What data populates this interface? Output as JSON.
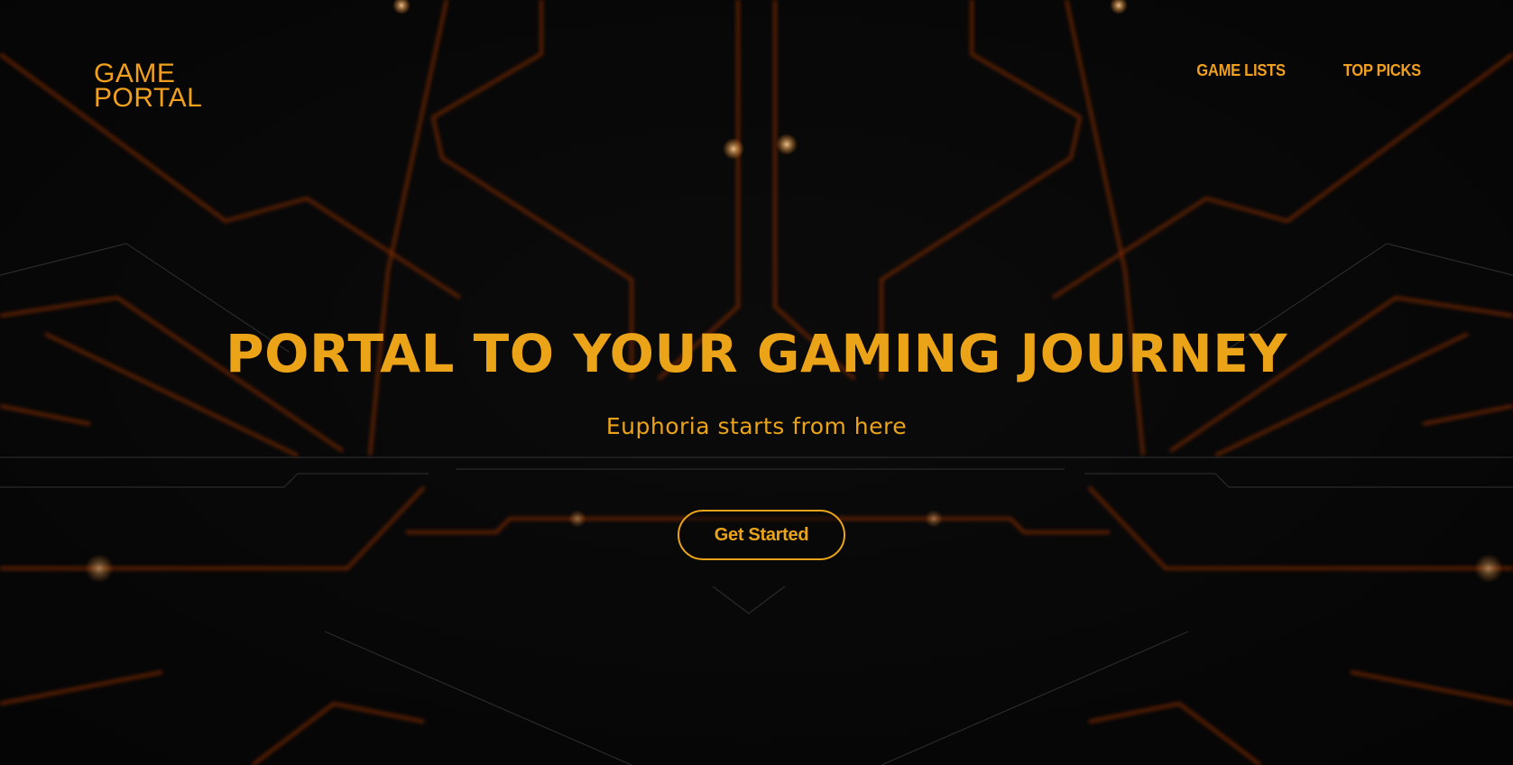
{
  "brand": {
    "logo_line1": "GAME",
    "logo_line2": "PORTAL"
  },
  "nav": {
    "items": [
      {
        "label": "GAME LISTS"
      },
      {
        "label": "TOP PICKS"
      }
    ]
  },
  "hero": {
    "title": "PORTAL TO YOUR GAMING JOURNEY",
    "subtitle": "Euphoria starts from here",
    "cta_label": "Get Started"
  },
  "colors": {
    "accent": "#eba417",
    "background": "#070707",
    "circuit_glow": "#b8400b"
  }
}
